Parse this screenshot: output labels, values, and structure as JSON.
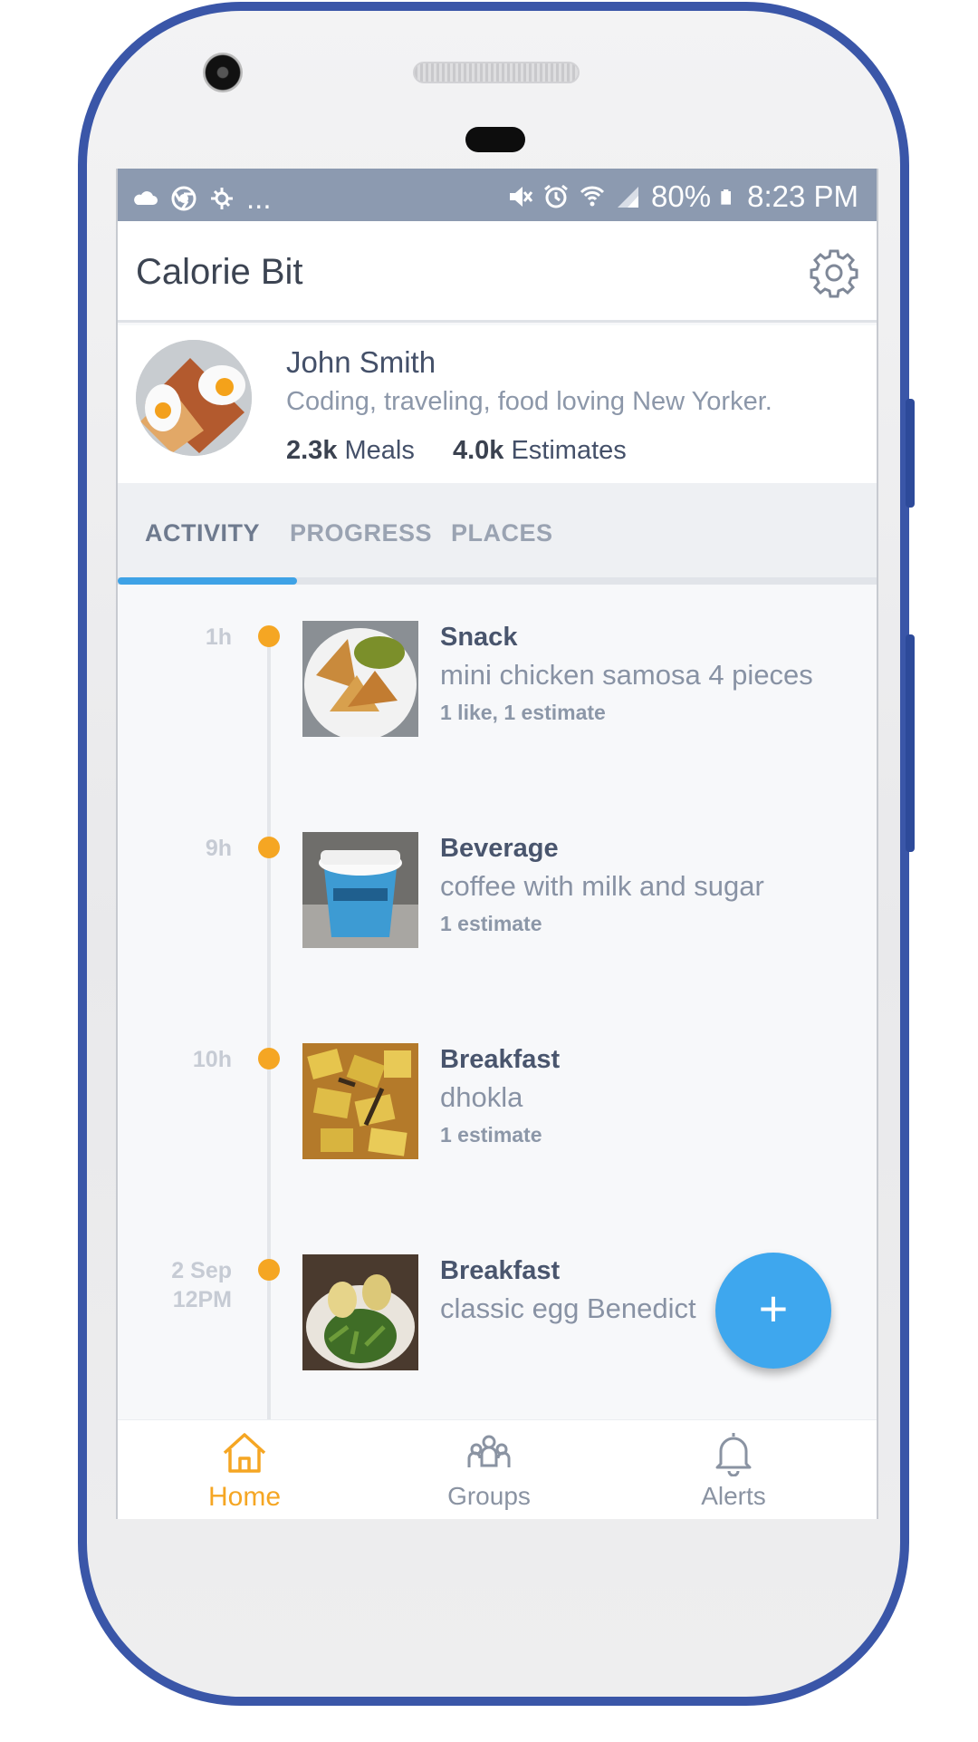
{
  "status_bar": {
    "battery": "80%",
    "time": "8:23 PM",
    "overflow": "..."
  },
  "app": {
    "title": "Calorie Bit"
  },
  "profile": {
    "name": "John Smith",
    "bio": "Coding, traveling, food loving New Yorker.",
    "meals_count": "2.3k",
    "meals_label": "Meals",
    "estimates_count": "4.0k",
    "estimates_label": "Estimates"
  },
  "tabs": [
    {
      "label": "ACTIVITY",
      "active": true
    },
    {
      "label": "PROGRESS",
      "active": false
    },
    {
      "label": "PLACES",
      "active": false
    }
  ],
  "feed": [
    {
      "time": "1h",
      "category": "Snack",
      "description": "mini chicken samosa 4 pieces",
      "meta": "1 like, 1 estimate"
    },
    {
      "time": "9h",
      "category": "Beverage",
      "description": "coffee with milk and sugar",
      "meta": "1 estimate"
    },
    {
      "time": "10h",
      "category": "Breakfast",
      "description": "dhokla",
      "meta": "1 estimate"
    },
    {
      "time": "2 Sep\n12PM",
      "time_line1": "2 Sep",
      "time_line2": "12PM",
      "category": "Breakfast",
      "description": "classic egg Benedict",
      "meta": ""
    }
  ],
  "fab": {
    "label": "+"
  },
  "bottom_nav": [
    {
      "label": "Home",
      "icon": "home-icon",
      "active": true
    },
    {
      "label": "Groups",
      "icon": "groups-icon",
      "active": false
    },
    {
      "label": "Alerts",
      "icon": "bell-icon",
      "active": false
    }
  ],
  "colors": {
    "accent_orange": "#f5a623",
    "accent_blue": "#3ea2e6",
    "frame_blue": "#3a56a8",
    "status_bar": "#8c9ab0"
  }
}
